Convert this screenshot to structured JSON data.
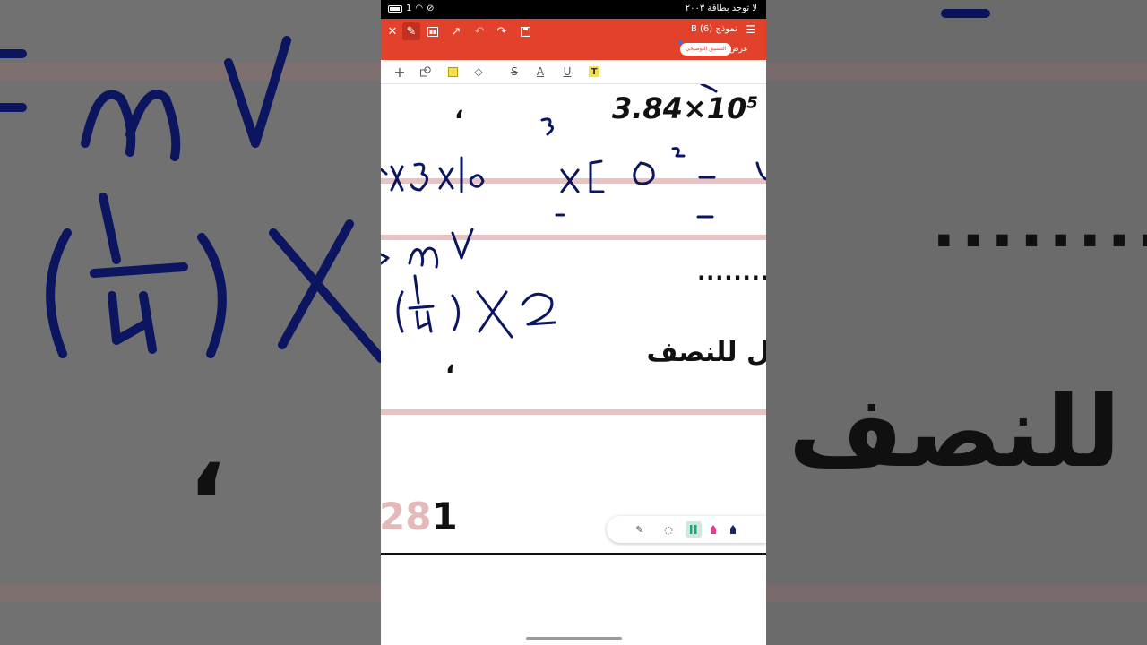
{
  "status_bar": {
    "carrier_text": "لا توجد بطاقة ٢٠٠٣",
    "sim_label": "1"
  },
  "toolbar": {
    "document_title": "نموذج (6) B",
    "pill_label": "التنسيق التوضيحي",
    "view_label": "عرض",
    "icons": [
      "close-icon",
      "pen-icon",
      "thumbnails-icon",
      "share-icon",
      "undo-icon",
      "redo-icon",
      "save-icon",
      "menu-icon"
    ],
    "accent_color": "#e2412c"
  },
  "subbar": {
    "icons": [
      "plus-icon",
      "shapes-icon",
      "highlight-square-icon",
      "eraser-icon",
      "strikethrough-icon",
      "text-color-icon",
      "underline-icon",
      "text-highlight-icon"
    ],
    "strike_label": "S",
    "color_label": "A",
    "underline_label": "U",
    "highlight_label": "T"
  },
  "document": {
    "equation_base": "3.84",
    "equation_op": "×",
    "equation_power_base": "10",
    "equation_exponent": "5",
    "comma_1": "،",
    "comma_2": "،",
    "dots": "........",
    "arabic_text": "ل للنصف",
    "page_faded": "28",
    "page_digit": "1"
  },
  "background": {
    "arabic_text": "ل للنصف",
    "dots": "........",
    "comma": "،"
  },
  "pen_dock": {
    "icons": [
      "pen-settings-icon",
      "lasso-icon",
      "pen-green-icon",
      "pen-pink-icon",
      "pen-navy-icon"
    ]
  }
}
